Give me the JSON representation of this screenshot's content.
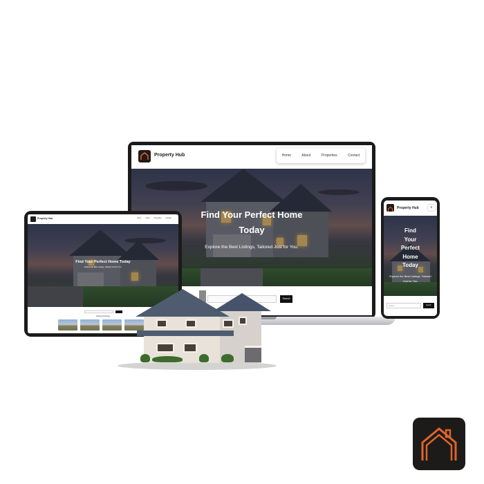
{
  "brand": {
    "name": "Property Hub",
    "accent": "#e0642a"
  },
  "nav": {
    "items": [
      "Home",
      "About",
      "Properties",
      "Contact"
    ]
  },
  "hero": {
    "title": "Find Your Perfect Home Today",
    "title_line1": "Find Your Perfect Home",
    "title_line2": "Today",
    "subtitle": "Explore the Best Listings, Tailored Just for You."
  },
  "phone": {
    "title": "Find\nYour\nPerfect\nHome\nToday",
    "subtitle": "Explore the Best Listings, Tailored Just for You.",
    "menu_icon": "≡"
  },
  "search": {
    "placeholder": "Search...",
    "button_label": "Search"
  },
  "featured": {
    "heading": "Featured Listings"
  },
  "icons": {
    "logo": "house-outline-icon",
    "menu": "hamburger-menu-icon"
  }
}
